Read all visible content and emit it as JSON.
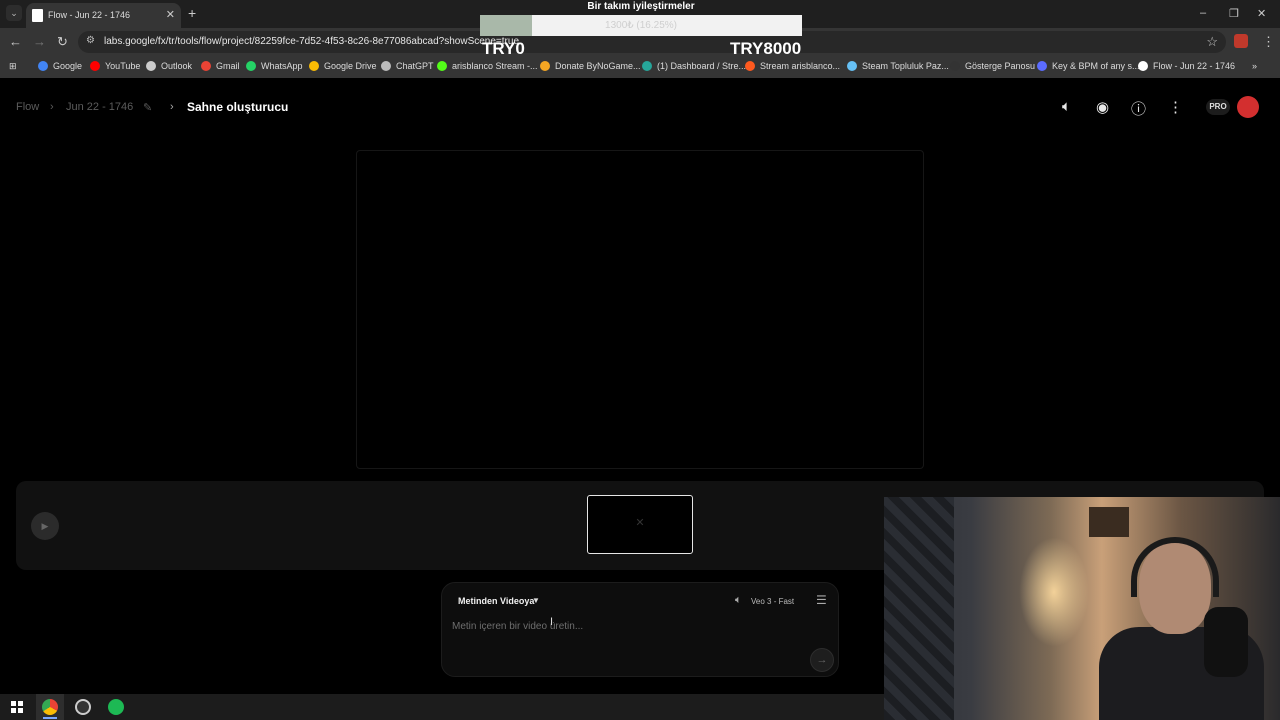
{
  "browser": {
    "tab_title": "Flow - Jun 22 - 1746",
    "tab_menu_icon": "chevron-down-icon",
    "new_tab": "+",
    "close": "✕",
    "url": "labs.google/fx/tr/tools/flow/project/82259fce-7d52-4f53-8c26-8e77086abcad?showScene=true",
    "bookmarks": [
      {
        "label": "Google",
        "color": "#4285f4"
      },
      {
        "label": "YouTube",
        "color": "#ff0000"
      },
      {
        "label": "Outlook",
        "color": "#cccccc"
      },
      {
        "label": "Gmail",
        "color": "#ea4335"
      },
      {
        "label": "WhatsApp",
        "color": "#25d366"
      },
      {
        "label": "Google Drive",
        "color": "#fbbc04"
      },
      {
        "label": "ChatGPT",
        "color": "#bbbbbb"
      },
      {
        "label": "arisblanco Stream -...",
        "color": "#53fc18"
      },
      {
        "label": "Donate ByNoGame...",
        "color": "#f5a623"
      },
      {
        "label": "(1) Dashboard / Stre...",
        "color": "#26a69a"
      },
      {
        "label": "Stream arisblanco...",
        "color": "#ff5a1f"
      },
      {
        "label": "Steam Topluluk Paz...",
        "color": "#66c0f4"
      },
      {
        "label": "Gösterge Panosu",
        "color": "#333333"
      },
      {
        "label": "Key & BPM of any s...",
        "color": "#5b6cff"
      },
      {
        "label": "Flow - Jun 22 - 1746",
        "color": "#ffffff"
      }
    ],
    "more_bookmarks": "»"
  },
  "overlay": {
    "title": "Bir takım iyileştirmeler",
    "progress_text": "1300₺ (16.25%)",
    "progress_fraction": 0.1625,
    "min_label": "TRY0",
    "max_label": "TRY8000"
  },
  "header": {
    "crumb_root": "Flow",
    "crumb_project": "Jun 22 - 1746",
    "crumb_current": "Sahne oluşturucu",
    "pro_badge": "PRO"
  },
  "prompt": {
    "mode_label": "Metinden Videoya",
    "model_label": "Veo 3 - Fast",
    "placeholder": "Metin içeren bir video üretin..."
  },
  "colors": {
    "background": "#000000",
    "overlay_fill": "#a9b8a9",
    "avatar": "#d32f2f"
  }
}
